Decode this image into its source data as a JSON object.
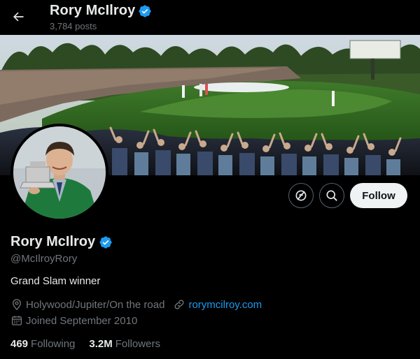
{
  "header": {
    "name": "Rory McIlroy",
    "post_count": "3,784 posts"
  },
  "profile": {
    "display_name": "Rory McIlroy",
    "handle": "@McIlroyRory",
    "bio": "Grand Slam winner",
    "location": "Holywood/Jupiter/On the road",
    "website": "rorymcilroy.com",
    "joined": "Joined September 2010",
    "following_count": "469",
    "following_label": "Following",
    "followers_count": "3.2M",
    "followers_label": "Followers"
  },
  "actions": {
    "follow_label": "Follow"
  },
  "icons": {
    "back": "arrow-left-icon",
    "verified": "verified-badge-icon",
    "subscribe": "subscribe-icon",
    "search": "search-icon",
    "location": "location-pin-icon",
    "link": "link-icon",
    "calendar": "calendar-icon"
  },
  "colors": {
    "background": "#000000",
    "text_primary": "#e7e9ea",
    "text_secondary": "#71767b",
    "accent": "#1d9bf0",
    "follow_bg": "#eff3f4"
  }
}
